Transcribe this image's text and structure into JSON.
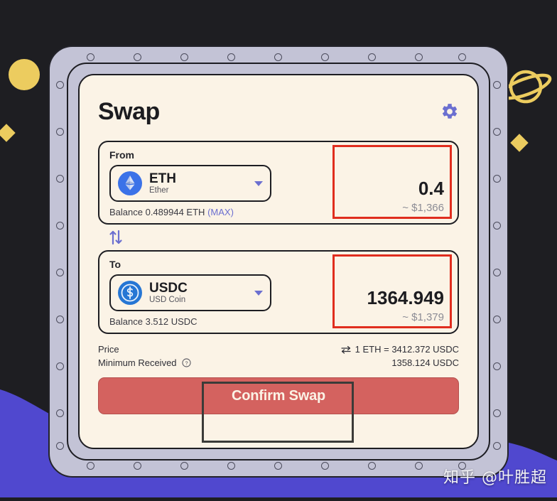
{
  "app": {
    "title": "Swap",
    "settings_icon": "gear-icon"
  },
  "from_panel": {
    "label": "From",
    "token_symbol": "ETH",
    "token_name": "Ether",
    "token_icon": "ethereum-icon",
    "caret_icon": "chevron-down-icon",
    "amount": "0.4",
    "amount_usd": "~ $1,366",
    "balance_text": "Balance 0.489944 ETH",
    "max_label": "(MAX)"
  },
  "swap_direction": {
    "icon": "swap-vertical-arrows-icon"
  },
  "to_panel": {
    "label": "To",
    "token_symbol": "USDC",
    "token_name": "USD Coin",
    "token_icon": "usdc-icon",
    "caret_icon": "chevron-down-icon",
    "amount": "1364.949",
    "amount_usd": "~ $1,379",
    "balance_text": "Balance 3.512 USDC"
  },
  "price_info": {
    "price_label": "Price",
    "price_swap_icon": "swap-horizontal-icon",
    "price_value": "1 ETH = 3412.372 USDC",
    "minimum_label": "Minimum Received",
    "minimum_help_icon": "question-circle-icon",
    "minimum_value": "1358.124 USDC"
  },
  "confirm": {
    "label": "Confirm Swap"
  },
  "watermark": {
    "text": "知乎 @叶胜超"
  },
  "colors": {
    "background": "#1e1e22",
    "background_accent": "#5048cf",
    "frame": "#c3c3d6",
    "card": "#fbf3e6",
    "accent_purple": "#6b6fd0",
    "annotation_red": "#e02d1e",
    "annotation_dark": "#3b3b38",
    "confirm_button": "#d4625f",
    "deco_yellow": "#eccc5f"
  },
  "decorations": [
    {
      "name": "yellow-circle",
      "shape": "circle"
    },
    {
      "name": "yellow-diamond-left",
      "shape": "diamond"
    },
    {
      "name": "saturn-planet",
      "shape": "planet"
    },
    {
      "name": "yellow-diamond-right",
      "shape": "diamond"
    }
  ]
}
